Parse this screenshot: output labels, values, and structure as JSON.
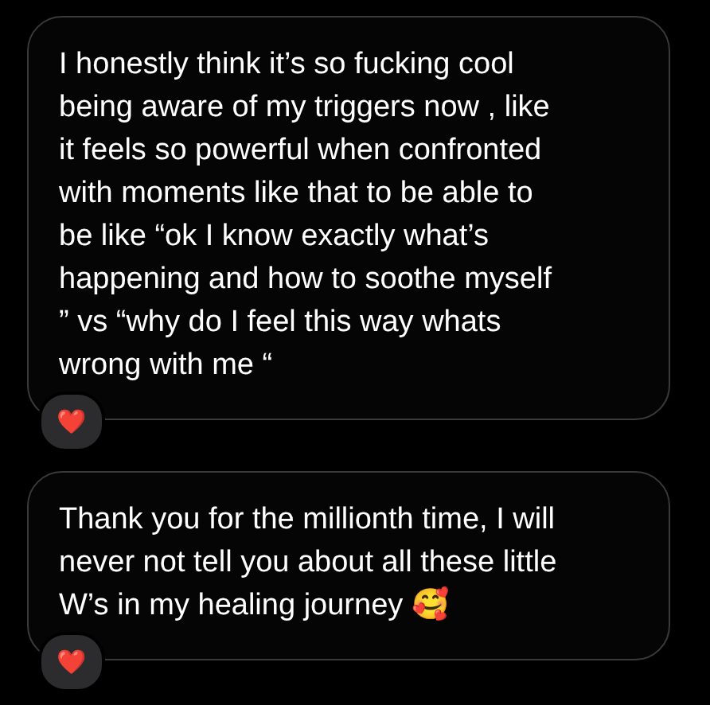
{
  "messages": [
    {
      "lines": [
        "I honestly think it’s so fucking cool",
        "being aware of my triggers now , like",
        "it feels so powerful when confronted",
        "with moments like that to be able to",
        "be like “ok I know exactly what’s",
        "happening and how to soothe myself",
        "” vs “why do I feel this way whats",
        "wrong with me “"
      ],
      "reaction": "❤️"
    },
    {
      "lines": [
        "Thank you for the millionth time, I will",
        "never not tell you about all these little",
        "W’s in my healing journey 🥰"
      ],
      "reaction": "❤️"
    }
  ]
}
